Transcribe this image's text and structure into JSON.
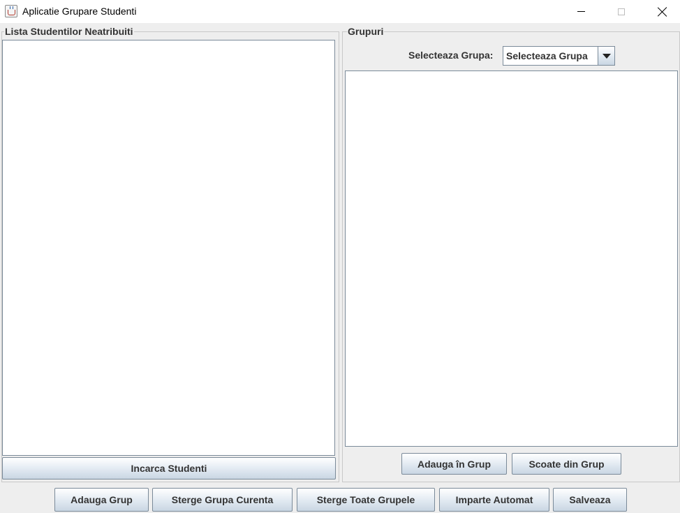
{
  "window": {
    "title": "Aplicatie Grupare Studenti",
    "app_icon": "java-cup-icon"
  },
  "left_panel": {
    "title": "Lista Studentilor Neatribuiti",
    "load_button": "Incarca Studenti"
  },
  "right_panel": {
    "title": "Grupuri",
    "select_label": "Selecteaza Grupa:",
    "select_value": "Selecteaza Grupa",
    "add_to_group_button": "Adauga în Grup",
    "remove_from_group_button": "Scoate din Grup"
  },
  "bottom_bar": {
    "add_group": "Adauga Grup",
    "delete_current": "Sterge Grupa Curenta",
    "delete_all": "Sterge Toate Grupele",
    "auto_split": "Imparte Automat",
    "save": "Salveaza"
  }
}
